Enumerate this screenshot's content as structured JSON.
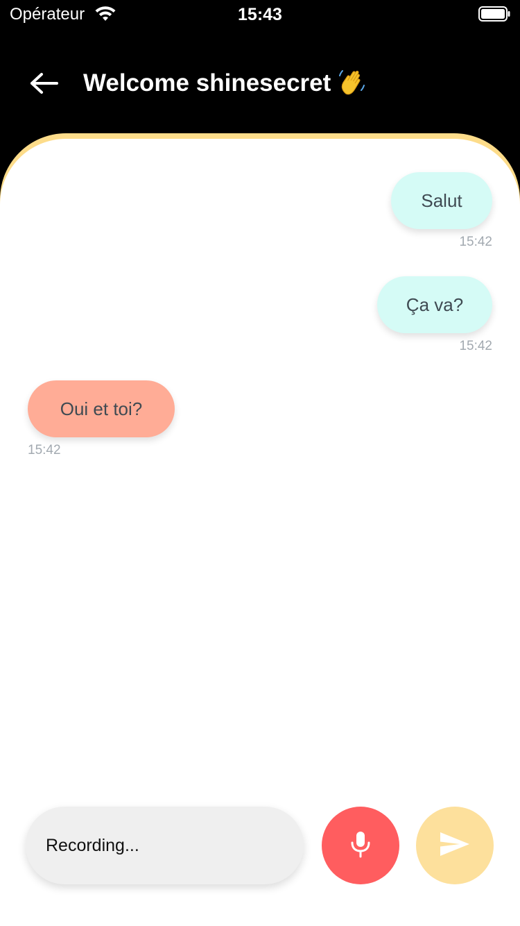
{
  "status_bar": {
    "carrier": "Opérateur",
    "time": "15:43",
    "icons": [
      "wifi-icon",
      "battery-icon"
    ]
  },
  "header": {
    "title": "Welcome shinesecret",
    "back_icon": "arrow-left-icon",
    "emoji_icon": "waving-hand-icon"
  },
  "messages": [
    {
      "direction": "sent",
      "text": "Salut",
      "time": "15:42"
    },
    {
      "direction": "sent",
      "text": "Ça va?",
      "time": "15:42"
    },
    {
      "direction": "received",
      "text": "Oui et toi?",
      "time": "15:42"
    }
  ],
  "composer": {
    "field_text": "Recording...",
    "mic_icon": "microphone-icon",
    "send_icon": "send-icon"
  },
  "colors": {
    "header_background": "#000000",
    "panel_accent": "#fddc8a",
    "sent_bubble": "#d5fbf6",
    "received_bubble": "#ffac96",
    "mic_button": "#ff5d5f",
    "send_button": "#fde09c",
    "input_background": "#efefef"
  }
}
